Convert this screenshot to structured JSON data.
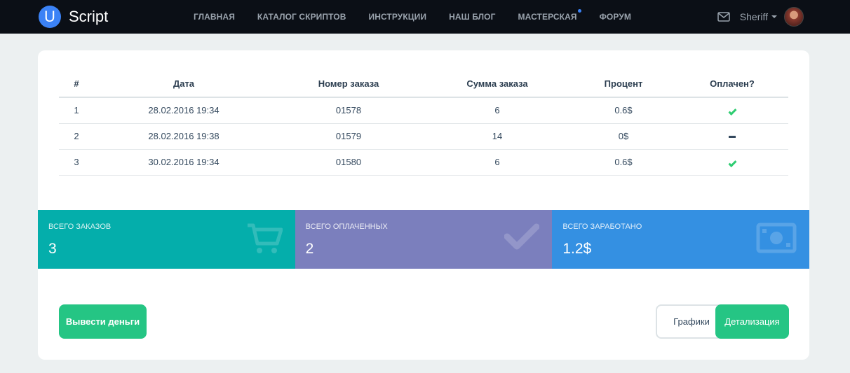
{
  "navbar": {
    "logo_letter": "U",
    "logo_text": "Script",
    "links": [
      "Главная",
      "Каталог скриптов",
      "Инструкции",
      "Наш блог",
      "Мастерская",
      "Форум"
    ],
    "username": "Sheriff"
  },
  "table": {
    "headers": [
      "#",
      "Дата",
      "Номер заказа",
      "Сумма заказа",
      "Процент",
      "Оплачен?"
    ],
    "rows": [
      {
        "num": "1",
        "date": "28.02.2016 19:34",
        "order": "01578",
        "sum": "6",
        "percent": "0.6$",
        "paid": "yes"
      },
      {
        "num": "2",
        "date": "28.02.2016 19:38",
        "order": "01579",
        "sum": "14",
        "percent": "0$",
        "paid": "no"
      },
      {
        "num": "3",
        "date": "30.02.2016 19:34",
        "order": "01580",
        "sum": "6",
        "percent": "0.6$",
        "paid": "yes"
      }
    ]
  },
  "stats": [
    {
      "label": "Всего заказов",
      "value": "3",
      "color": "#04aeab",
      "icon": "cart-icon"
    },
    {
      "label": "Всего оплаченных",
      "value": "2",
      "color": "#7b7fbd",
      "icon": "check-icon"
    },
    {
      "label": "Всего заработано",
      "value": "1.2$",
      "color": "#3490e2",
      "icon": "money-icon"
    }
  ],
  "buttons": {
    "withdraw": "Вывести деньги",
    "charts": "Графики",
    "details": "Детализация"
  }
}
